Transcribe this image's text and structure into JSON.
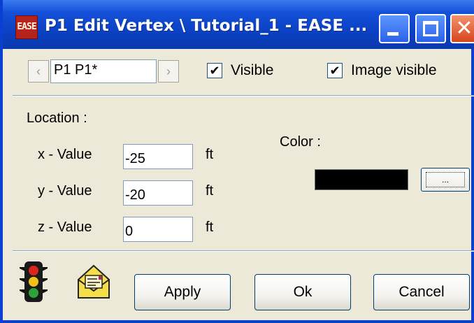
{
  "window": {
    "app_icon_text": "EASE",
    "title": "P1 Edit Vertex \\ Tutorial_1 - EASE ..."
  },
  "toolbar": {
    "prev_glyph": "‹",
    "next_glyph": "›",
    "vertex_name": "P1 P1*",
    "visible": {
      "label": "Visible",
      "checked": true
    },
    "image_visible": {
      "label": "Image visible",
      "checked": true
    }
  },
  "location": {
    "heading": "Location :",
    "x": {
      "label": "x - Value",
      "value": "-25",
      "unit": "ft"
    },
    "y": {
      "label": "y - Value",
      "value": "-20",
      "unit": "ft"
    },
    "z": {
      "label": "z - Value",
      "value": "0",
      "unit": "ft"
    }
  },
  "color": {
    "label": "Color :",
    "value": "#000000",
    "button_label": "..."
  },
  "icons": {
    "traffic_light": "traffic-light-icon",
    "mail": "mail-icon"
  },
  "buttons": {
    "apply": "Apply",
    "ok": "Ok",
    "cancel": "Cancel"
  },
  "check_glyph": "✔"
}
